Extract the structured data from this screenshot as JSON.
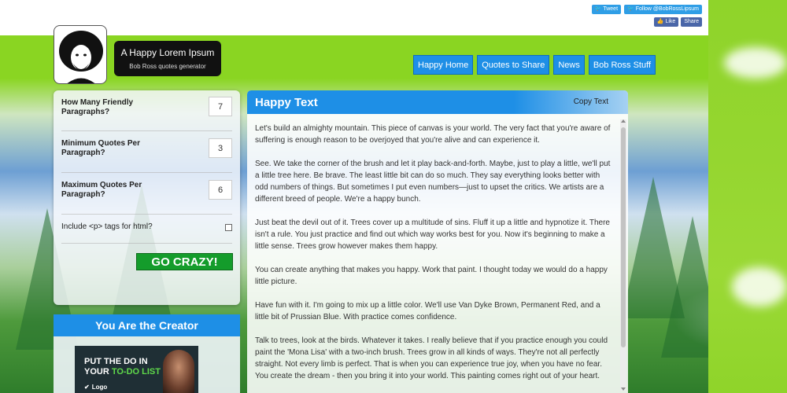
{
  "social": {
    "tweet_label": "Tweet",
    "follow_label": "Follow @BobRossLipsum",
    "like_label": "Like",
    "share_label": "Share"
  },
  "site": {
    "title": "A Happy Lorem Ipsum",
    "subtitle": "Bob Ross quotes generator"
  },
  "nav": {
    "items": [
      "Happy Home",
      "Quotes to Share",
      "News",
      "Bob Ross Stuff"
    ]
  },
  "form": {
    "paragraphs_label": "How Many Friendly Paragraphs?",
    "paragraphs_value": "7",
    "min_quotes_label": "Minimum Quotes Per Paragraph?",
    "min_quotes_value": "3",
    "max_quotes_label": "Maximum Quotes Per Paragraph?",
    "max_quotes_value": "6",
    "ptags_label": "Include <p> tags for html?",
    "ptags_checked": false,
    "go_label": "GO CRAZY!"
  },
  "creator": {
    "heading": "You Are the Creator",
    "ad_line1": "PUT THE DO IN",
    "ad_line2_prefix": "YOUR ",
    "ad_line2_highlight": "TO-DO LIST",
    "ad_logo": "Logo"
  },
  "main": {
    "heading": "Happy Text",
    "copy_label": "Copy Text",
    "paragraphs": [
      "Let's build an almighty mountain. This piece of canvas is your world. The very fact that you're aware of suffering is enough reason to be overjoyed that you're alive and can experience it.",
      "See. We take the corner of the brush and let it play back-and-forth. Maybe, just to play a little, we'll put a little tree here. Be brave. The least little bit can do so much. They say everything looks better with odd numbers of things. But sometimes I put even numbers—just to upset the critics. We artists are a different breed of people. We're a happy bunch.",
      "Just beat the devil out of it. Trees cover up a multitude of sins. Fluff it up a little and hypnotize it. There isn't a rule. You just practice and find out which way works best for you. Now it's beginning to make a little sense. Trees grow however makes them happy.",
      "You can create anything that makes you happy. Work that paint. I thought today we would do a happy little picture.",
      "Have fun with it. I'm going to mix up a little color. We'll use Van Dyke Brown, Permanent Red, and a little bit of Prussian Blue. With practice comes confidence.",
      "Talk to trees, look at the birds. Whatever it takes. I really believe that if you practice enough you could paint the 'Mona Lisa' with a two-inch brush. Trees grow in all kinds of ways. They're not all perfectly straight. Not every limb is perfect. That is when you can experience true joy, when you have no fear. You create the dream - then you bring it into your world. This painting comes right out of your heart."
    ]
  },
  "colors": {
    "accent_blue": "#1e8fe6",
    "go_green": "#149c2b",
    "page_green": "#8ad522"
  }
}
